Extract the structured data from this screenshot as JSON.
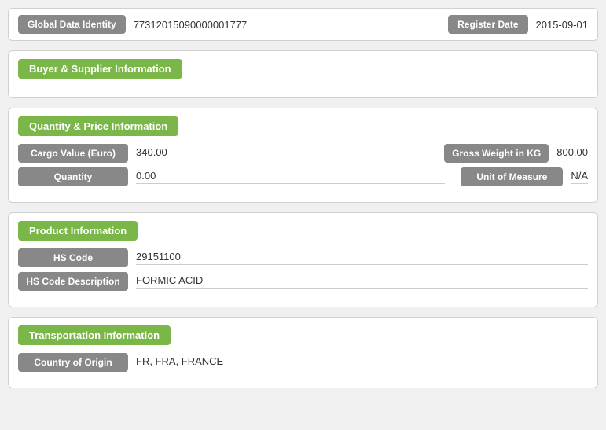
{
  "topBar": {
    "globalLabel": "Global Data Identity",
    "globalValue": "77312015090000001777",
    "registerLabel": "Register Date",
    "registerValue": "2015-09-01"
  },
  "sections": {
    "buyerSupplier": {
      "header": "Buyer & Supplier Information"
    },
    "quantityPrice": {
      "header": "Quantity & Price Information",
      "fields": {
        "cargoLabel": "Cargo Value (Euro)",
        "cargoValue": "340.00",
        "grossLabel": "Gross Weight in KG",
        "grossValue": "800.00",
        "quantityLabel": "Quantity",
        "quantityValue": "0.00",
        "uomLabel": "Unit of Measure",
        "uomValue": "N/A"
      }
    },
    "product": {
      "header": "Product Information",
      "fields": {
        "hsCodeLabel": "HS Code",
        "hsCodeValue": "29151100",
        "hsDescLabel": "HS Code Description",
        "hsDescValue": "FORMIC ACID"
      }
    },
    "transportation": {
      "header": "Transportation Information",
      "fields": {
        "countryLabel": "Country of Origin",
        "countryValue": "FR, FRA, FRANCE"
      }
    }
  }
}
